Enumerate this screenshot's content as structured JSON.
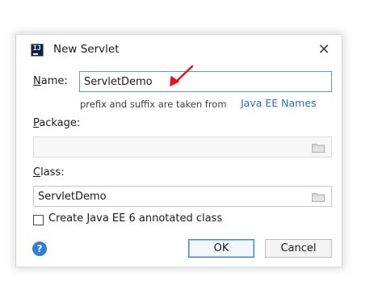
{
  "dialog": {
    "title": "New Servlet",
    "close_icon": "close-icon",
    "app_icon": "intellij-logo-icon"
  },
  "name_field": {
    "mnemonic": "N",
    "label_rest": "ame:",
    "value": "ServletDemo",
    "hint": "prefix and suffix are taken from",
    "hint_link": "Java EE Names"
  },
  "package_field": {
    "mnemonic": "P",
    "label_rest": "ackage:",
    "value": ""
  },
  "class_field": {
    "mnemonic": "C",
    "label_rest": "lass:",
    "value": "ServletDemo"
  },
  "annotated_checkbox": {
    "label": "Create Java EE 6 annotated class",
    "checked": false
  },
  "buttons": {
    "ok": "OK",
    "cancel": "Cancel",
    "help": "?"
  },
  "colors": {
    "focus_border": "#5b9bd5",
    "link": "#2a6fc2",
    "help": "#2f7fd9",
    "annotation_arrow": "#e0141a"
  }
}
